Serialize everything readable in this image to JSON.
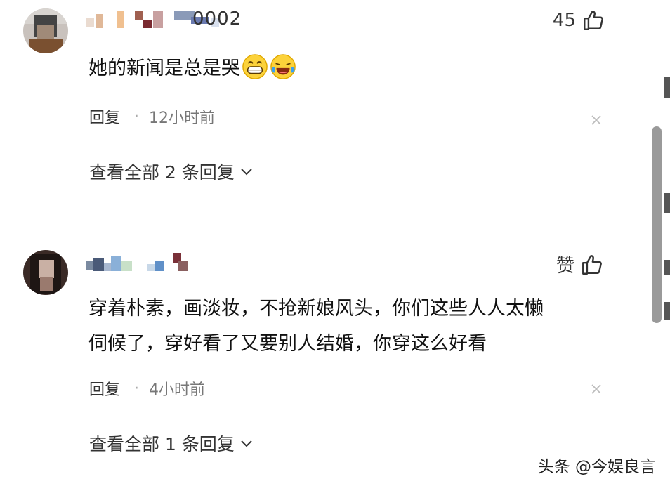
{
  "comments": [
    {
      "username_suffix": "0002",
      "like_count": "45",
      "text": "她的新闻是总是哭",
      "emojis": [
        "grinning-face-emoji",
        "tears-of-joy-emoji"
      ],
      "reply_label": "回复",
      "separator": "·",
      "time": "12小时前",
      "view_all": "查看全部 2 条回复"
    },
    {
      "like_label": "赞",
      "text_line1": "穿着朴素，画淡妆，不抢新娘风头，你们这些人人太懒",
      "text_line2": "伺候了，穿好看了又要别人结婚，你穿这么好看",
      "reply_label": "回复",
      "separator": "·",
      "time": "4小时前",
      "view_all": "查看全部 1 条回复"
    }
  ],
  "watermark": "头条 @今娱良言",
  "icons": {
    "like": "thumbs-up-icon",
    "close": "close-icon",
    "expand": "chevron-down-icon"
  },
  "colors": {
    "text": "#111111",
    "meta": "#777777",
    "scrollbar": "#9a9a9a"
  }
}
